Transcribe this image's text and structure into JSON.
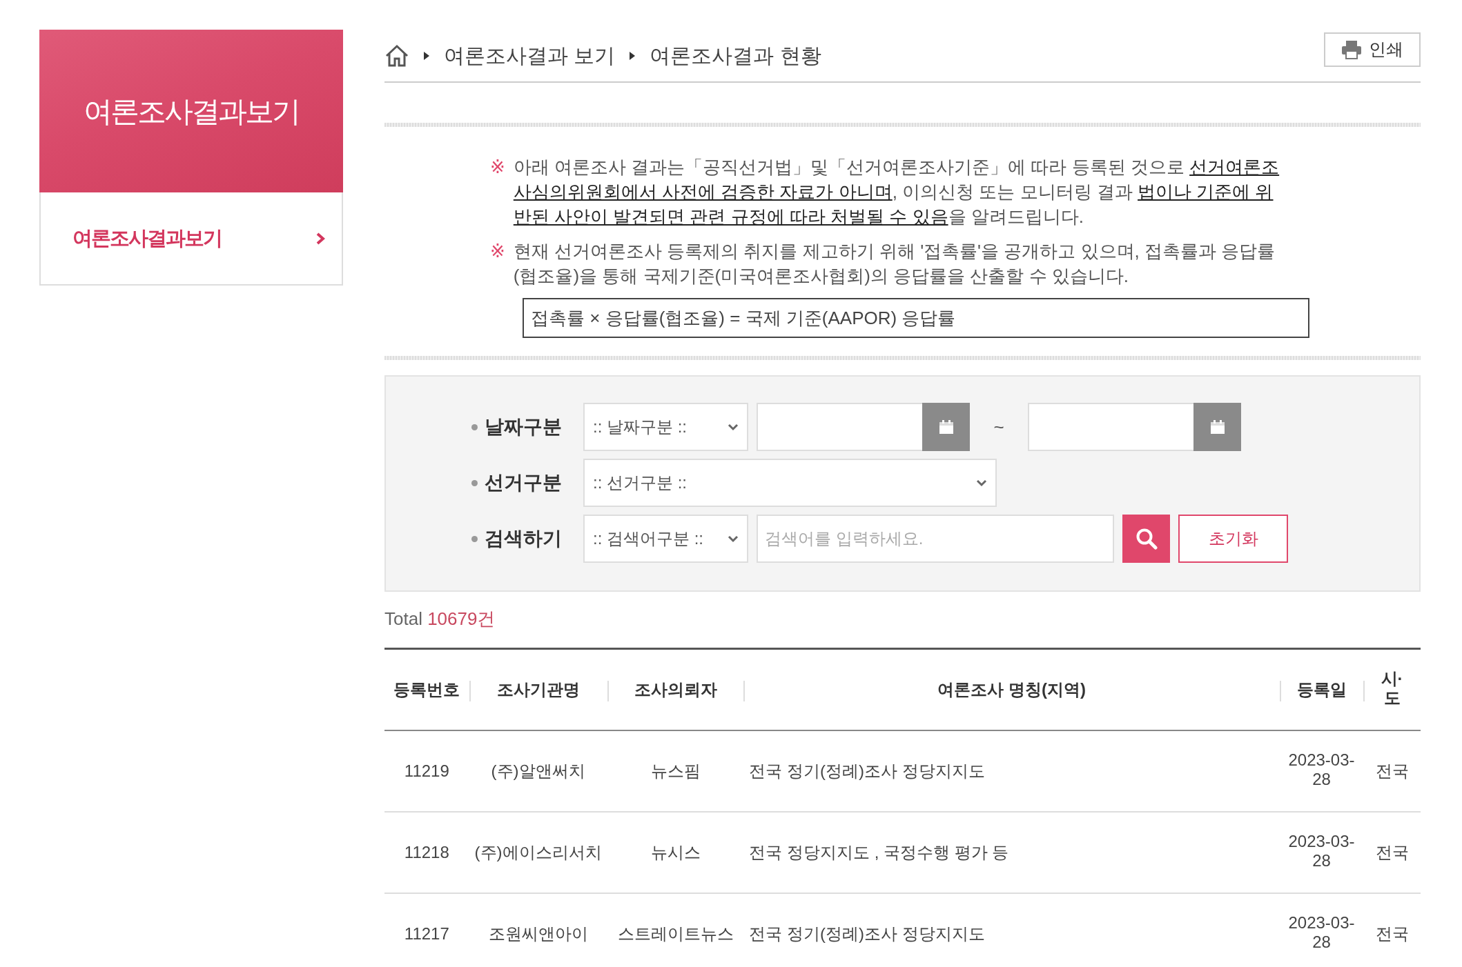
{
  "sidebar": {
    "title": "여론조사결과보기",
    "items": [
      {
        "label": "여론조사결과보기",
        "selected": true
      }
    ]
  },
  "breadcrumb": [
    "여론조사결과 보기",
    "여론조사결과 현황"
  ],
  "print_button": "인쇄",
  "notices": [
    {
      "mark": "※",
      "segments": [
        {
          "text": "아래 여론조사 결과는「공직선거법」및「선거여론조사기준」에 따라 등록된 것으로 ",
          "underlined": false
        },
        {
          "text": "선거여론조사심의위원회에서 사전에 검증한 자료가 아니며",
          "underlined": true
        },
        {
          "text": ", 이의신청 또는 모니터링 결과 ",
          "underlined": false
        },
        {
          "text": "법이나 기준에 위반된 사안이 발견되면 관련 규정에 따라 처벌될 수 있음",
          "underlined": true
        },
        {
          "text": "을 알려드립니다.",
          "underlined": false
        }
      ]
    },
    {
      "mark": "※",
      "segments": [
        {
          "text": "현재 선거여론조사 등록제의 취지를 제고하기 위해 '접촉률'을 공개하고 있으며, 접촉률과 응답률(협조율)을 통해 국제기준(미국여론조사협회)의 응답률을 산출할 수 있습니다.",
          "underlined": false
        }
      ]
    }
  ],
  "formula": "접촉률 × 응답률(협조율) = 국제 기준(AAPOR) 응답률",
  "search": {
    "rows": [
      {
        "label": "날짜구분",
        "fields": [
          {
            "kind": "select",
            "value": ":: 날짜구분 ::"
          },
          {
            "kind": "date"
          },
          {
            "kind": "separator",
            "text": "~"
          },
          {
            "kind": "date"
          }
        ]
      },
      {
        "label": "선거구분",
        "fields": [
          {
            "kind": "wide-select",
            "value": ":: 선거구분 ::"
          }
        ]
      },
      {
        "label": "검색하기",
        "fields": [
          {
            "kind": "select",
            "value": ":: 검색어구분 ::"
          },
          {
            "kind": "text",
            "placeholder": "검색어를 입력하세요."
          },
          {
            "kind": "search-button"
          },
          {
            "kind": "reset-button",
            "text": "초기화"
          }
        ]
      }
    ]
  },
  "total": {
    "label": "Total",
    "count": "10679건"
  },
  "table": {
    "columns": [
      "등록번호",
      "조사기관명",
      "조사의뢰자",
      "여론조사 명칭(지역)",
      "등록일",
      "시·도"
    ],
    "rows": [
      [
        "11219",
        "(주)알앤써치",
        "뉴스핌",
        "전국 정기(정례)조사 정당지지도",
        "2023-03-28",
        "전국"
      ],
      [
        "11218",
        "(주)에이스리서치",
        "뉴시스",
        "전국 정당지지도 , 국정수행 평가 등",
        "2023-03-28",
        "전국"
      ],
      [
        "11217",
        "조원씨앤아이",
        "스트레이트뉴스",
        "전국 정기(정례)조사 정당지지도",
        "2023-03-28",
        "전국"
      ]
    ]
  }
}
